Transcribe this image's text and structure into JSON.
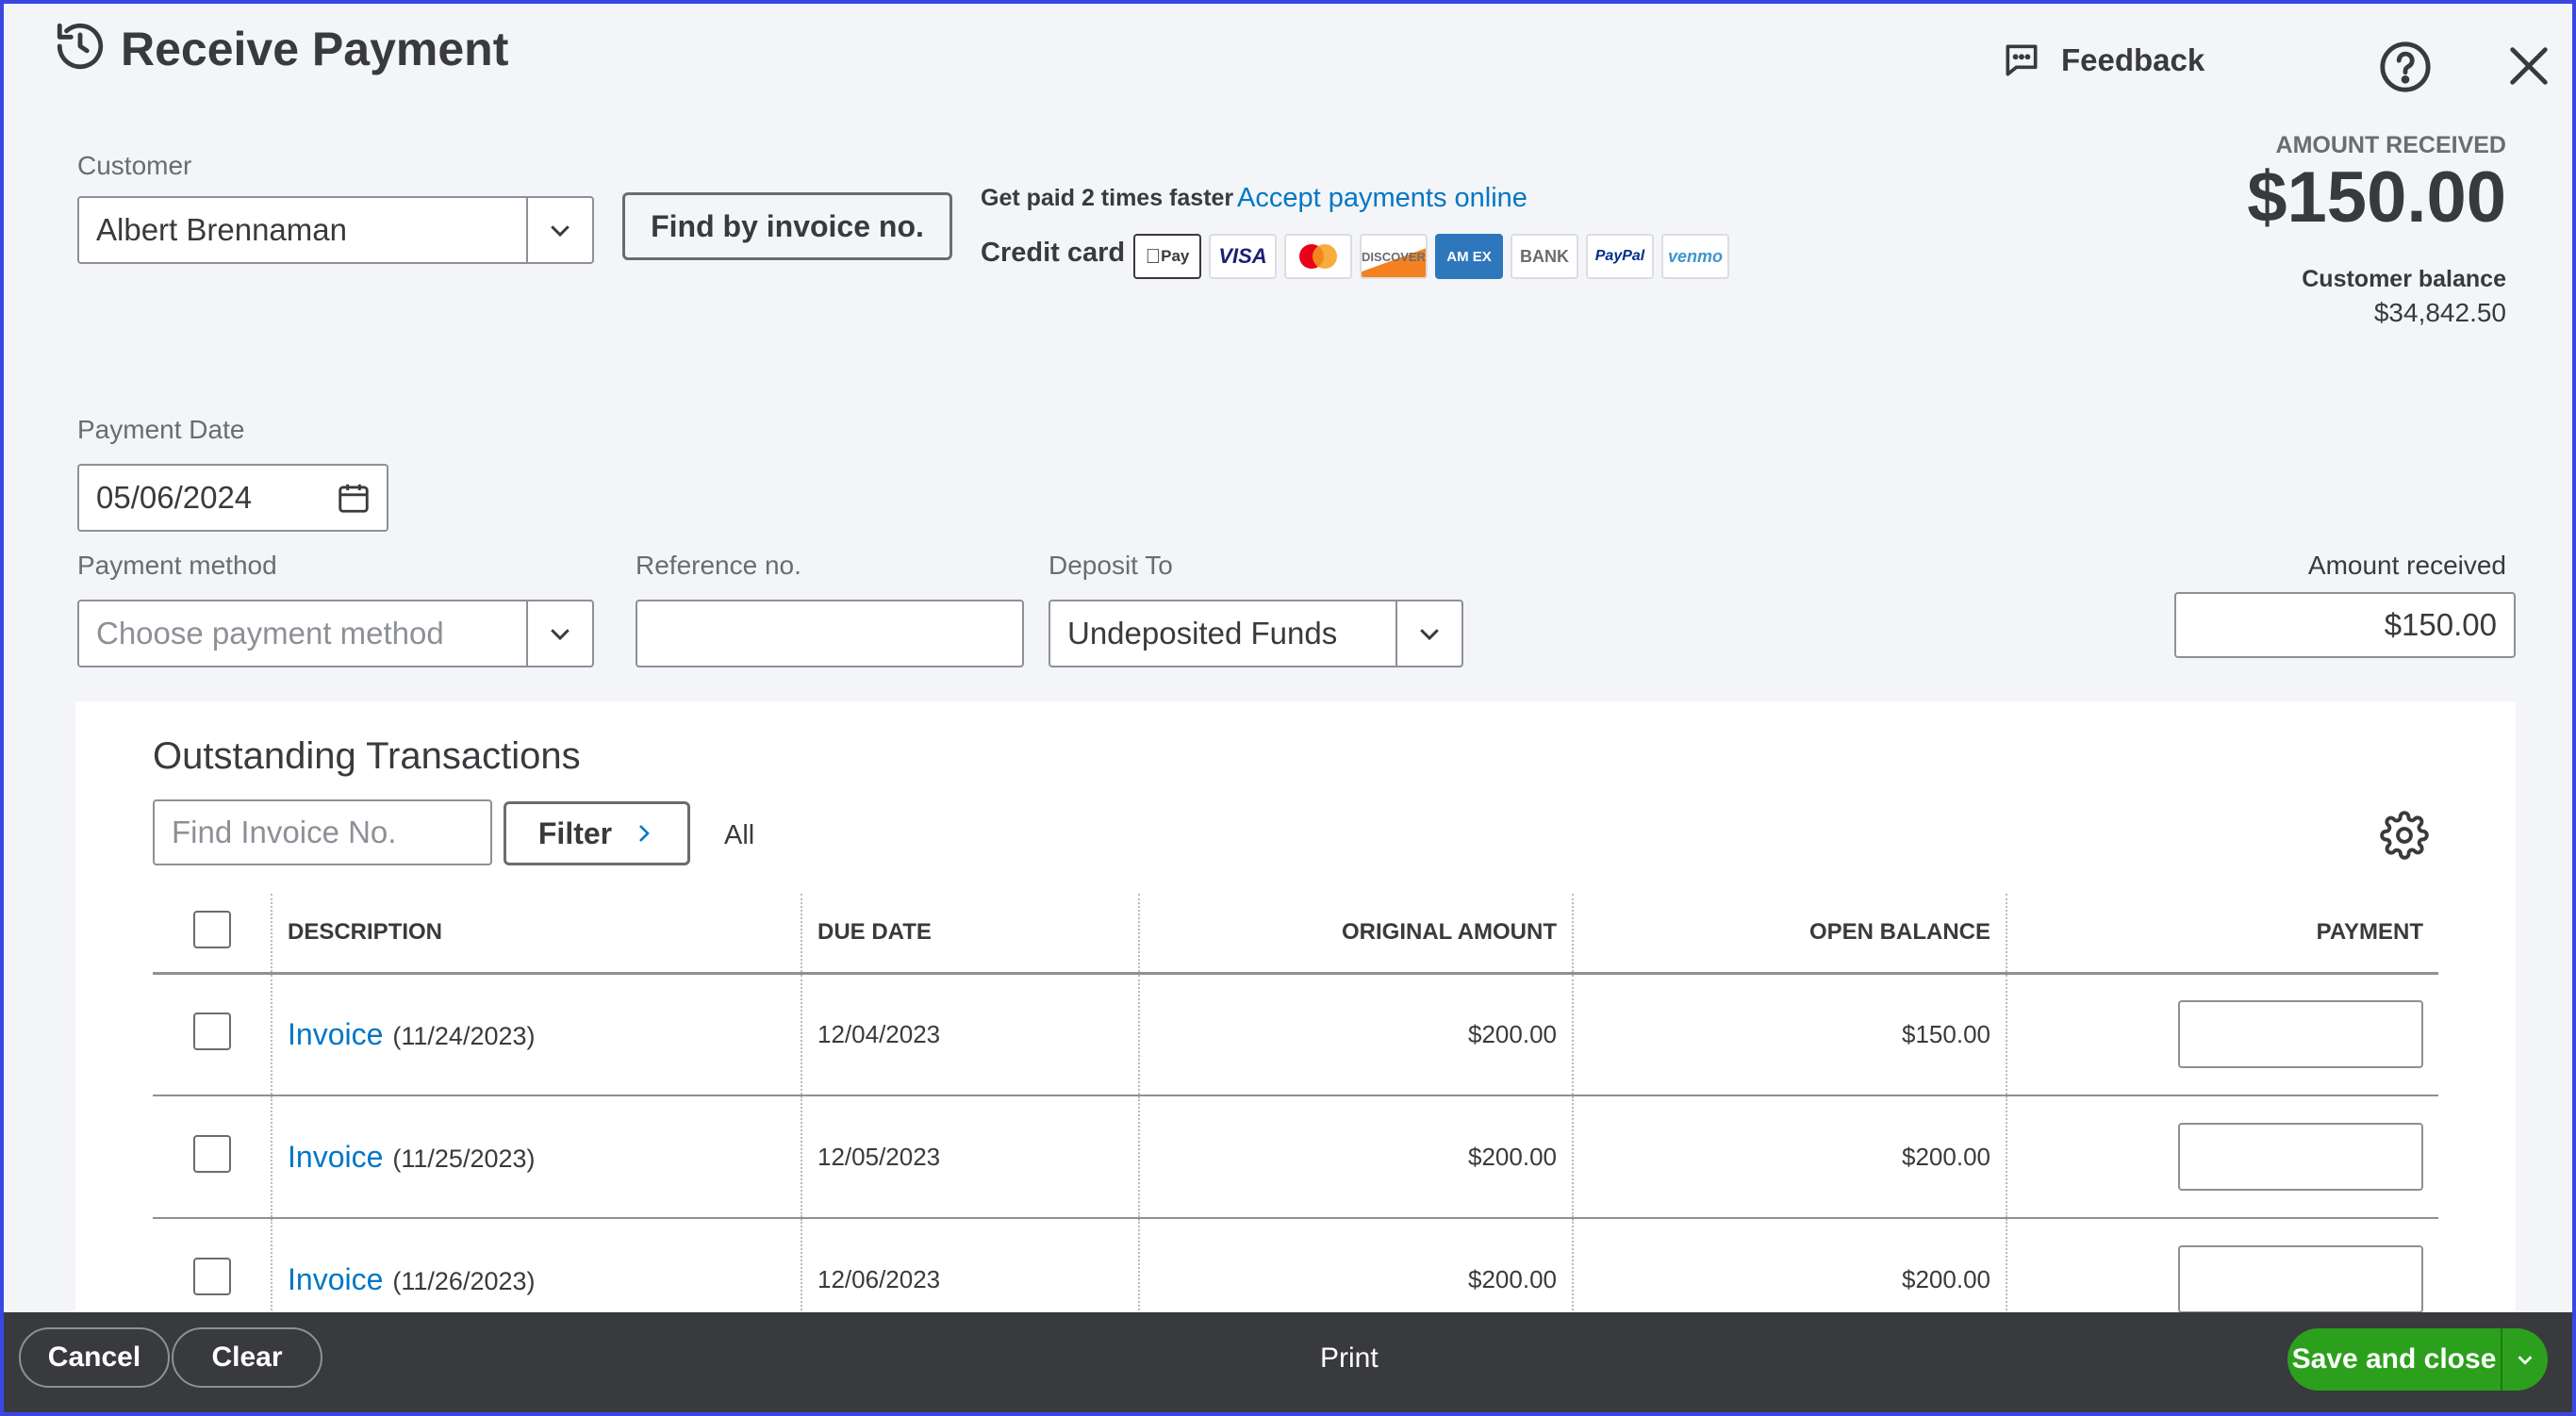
{
  "header": {
    "title": "Receive Payment",
    "feedback_label": "Feedback"
  },
  "customer": {
    "label": "Customer",
    "value": "Albert Brennaman",
    "find_button": "Find by invoice no."
  },
  "promo": {
    "get_paid": "Get paid 2 times faster",
    "accept_link": "Accept payments online",
    "credit_card_label": "Credit card",
    "cards": [
      "Pay",
      "VISA",
      "",
      "DISCOVER",
      "AM EX",
      "BANK",
      "PayPal",
      "venmo"
    ]
  },
  "summary": {
    "amount_received_label": "AMOUNT RECEIVED",
    "amount_received": "$150.00",
    "customer_balance_label": "Customer balance",
    "customer_balance": "$34,842.50"
  },
  "payment_date": {
    "label": "Payment Date",
    "value": "05/06/2024"
  },
  "payment_method": {
    "label": "Payment method",
    "placeholder": "Choose payment method"
  },
  "reference": {
    "label": "Reference no.",
    "value": ""
  },
  "deposit_to": {
    "label": "Deposit To",
    "value": "Undeposited Funds"
  },
  "amount_received_field": {
    "label": "Amount received",
    "value": "$150.00"
  },
  "outstanding": {
    "title": "Outstanding Transactions",
    "search_placeholder": "Find Invoice No.",
    "filter_label": "Filter",
    "all_label": "All",
    "columns": [
      "DESCRIPTION",
      "DUE DATE",
      "ORIGINAL AMOUNT",
      "OPEN BALANCE",
      "PAYMENT"
    ],
    "rows": [
      {
        "link": "Invoice",
        "date": "(11/24/2023)",
        "due": "12/04/2023",
        "original": "$200.00",
        "open": "$150.00"
      },
      {
        "link": "Invoice",
        "date": "(11/25/2023)",
        "due": "12/05/2023",
        "original": "$200.00",
        "open": "$200.00"
      },
      {
        "link": "Invoice",
        "date": "(11/26/2023)",
        "due": "12/06/2023",
        "original": "$200.00",
        "open": "$200.00"
      }
    ]
  },
  "footer": {
    "cancel": "Cancel",
    "clear": "Clear",
    "print": "Print",
    "save": "Save and close"
  },
  "colors": {
    "accent_blue": "#0077c5",
    "save_green": "#2ca01c",
    "footer_bg": "#393a3d"
  }
}
